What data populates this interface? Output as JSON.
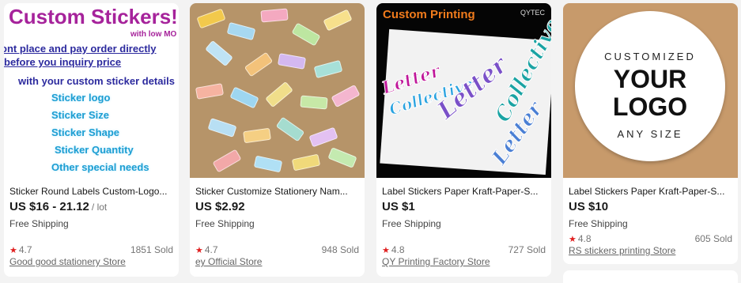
{
  "cards": [
    {
      "title": "Sticker Round Labels Custom-Logo...",
      "price": "US $16 - 21.12",
      "unit": "/ lot",
      "shipping": "Free Shipping",
      "rating": "4.7",
      "sold": "1851 Sold",
      "store": "Good good stationery Store",
      "image": {
        "headline": "Custom Stickers!",
        "sub": "with low MO",
        "line1": "ont place and pay order directly",
        "line2": "before you inquiry price",
        "line3": "with your custom sticker details",
        "features": [
          "Sticker logo",
          "Sticker Size",
          "Sticker Shape",
          "Sticker Quantity",
          "Other special needs"
        ]
      }
    },
    {
      "title": "Sticker Customize Stationery Nam...",
      "price": "US $2.92",
      "shipping": "Free Shipping",
      "rating": "4.7",
      "sold": "948 Sold",
      "store": "ey Official Store"
    },
    {
      "title": "Label Stickers Paper Kraft-Paper-S...",
      "price": "US $1",
      "shipping": "Free Shipping",
      "rating": "4.8",
      "sold": "727 Sold",
      "store": "QY Printing Factory Store",
      "image": {
        "headline": "Custom Printing",
        "brand": "QYTEC",
        "art_text": [
          "Letter",
          "Collective",
          "Letter",
          "Collective",
          "Letter"
        ]
      }
    },
    {
      "title": "Label Stickers Paper Kraft-Paper-S...",
      "price": "US $10",
      "shipping": "Free Shipping",
      "rating": "4.8",
      "sold": "605 Sold",
      "store": "RS stickers printing Store",
      "image": {
        "top": "CUSTOMIZED",
        "line1": "YOUR",
        "line2": "LOGO",
        "bottom": "ANY SIZE"
      }
    }
  ],
  "colors": {
    "star": "#e02020",
    "headline_purple": "#a6239b",
    "link_blue": "#2c2a9e",
    "feature_cyan": "#1c9ed2",
    "orange": "#f07b1c"
  },
  "icons": {
    "rating": "star-icon"
  }
}
